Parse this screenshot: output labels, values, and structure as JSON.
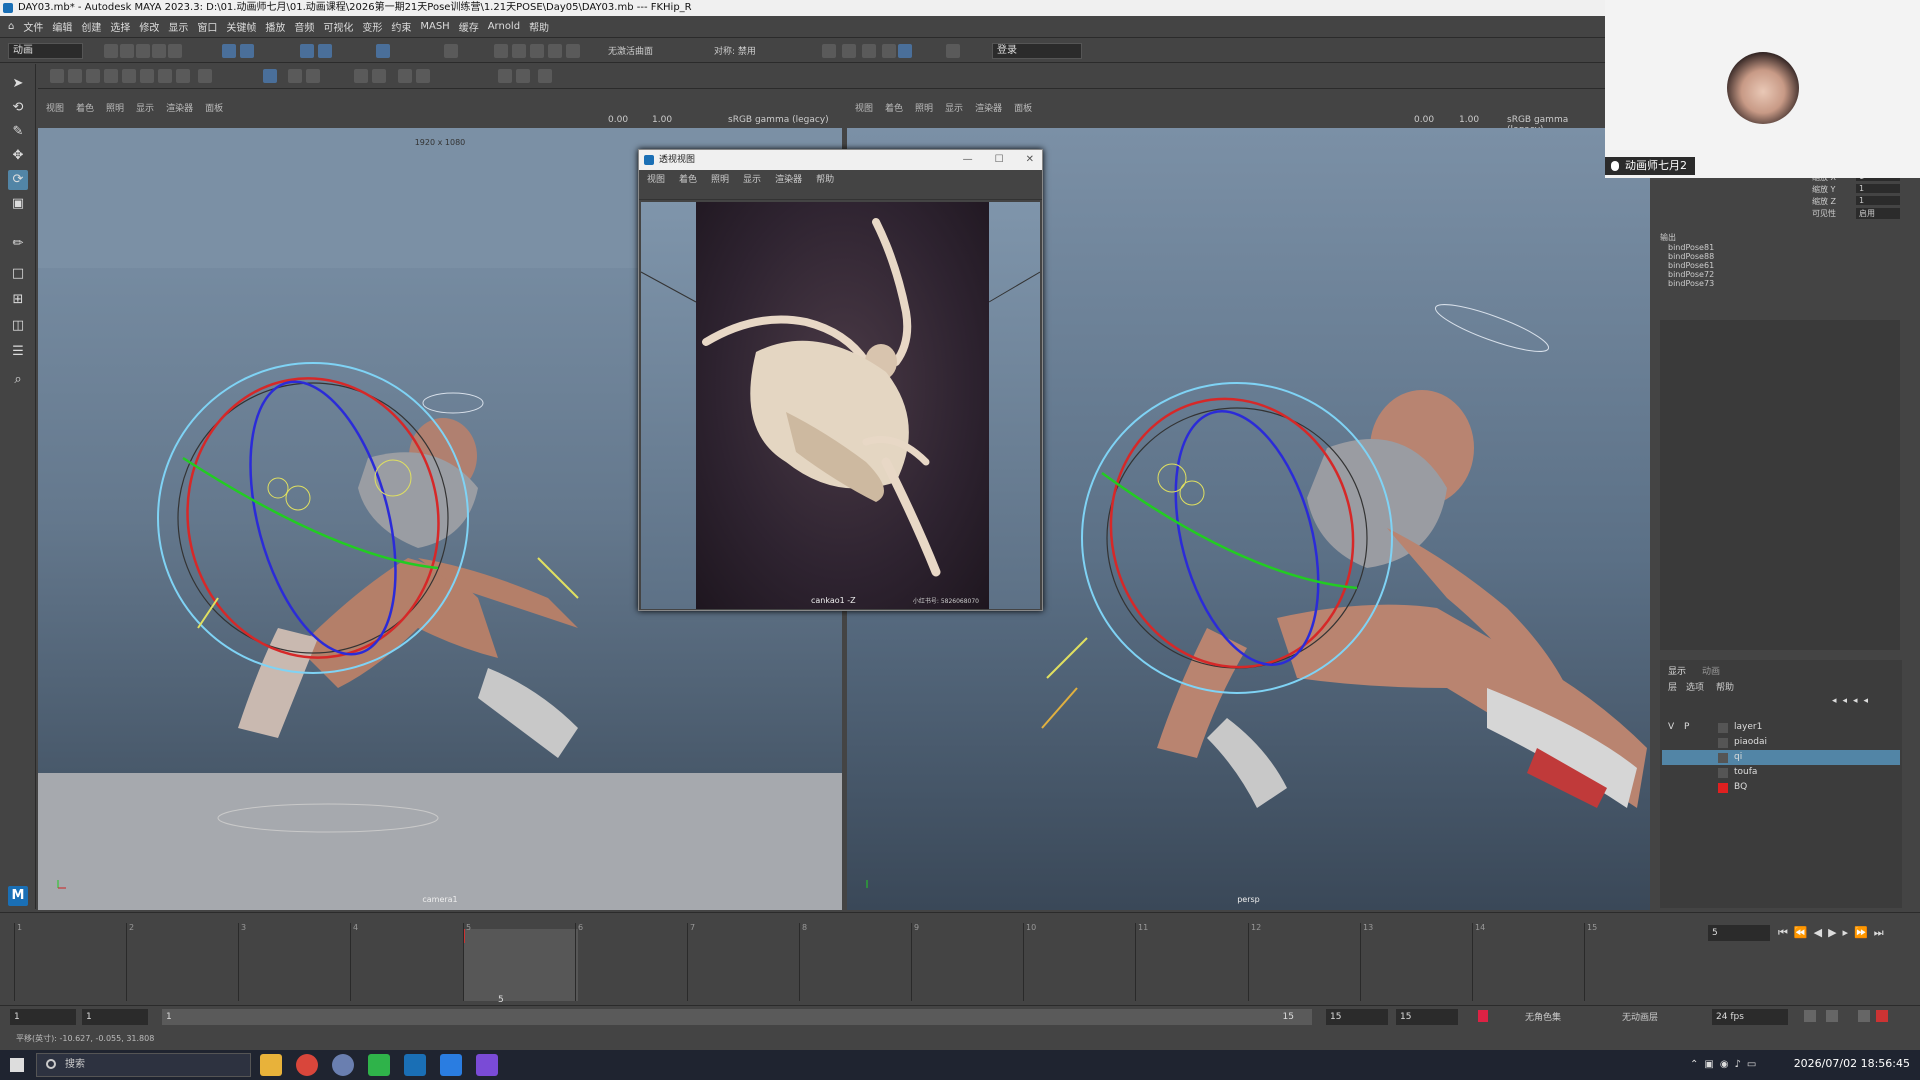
{
  "window": {
    "title": "DAY03.mb* - Autodesk MAYA 2023.3: D:\\01.动画师七月\\01.动画课程\\2026第一期21天Pose训练营\\1.21天POSE\\Day05\\DAY03.mb  ---  FKHip_R"
  },
  "menu": [
    "文件",
    "编辑",
    "创建",
    "选择",
    "修改",
    "显示",
    "窗口",
    "关键帧",
    "播放",
    "音频",
    "可视化",
    "变形",
    "约束",
    "MASH",
    "缓存",
    "Arnold",
    "帮助"
  ],
  "statusline": {
    "mode": "动画",
    "no_live": "无激活曲面",
    "symmetry": "对称: 禁用",
    "login": "登录"
  },
  "viewport_left": {
    "menu": [
      "视图",
      "着色",
      "照明",
      "显示",
      "渲染器",
      "面板"
    ],
    "exposure": "0.00",
    "gamma": "1.00",
    "colorspace": "sRGB gamma (legacy)",
    "resolution": "1920 x 1080",
    "camera": "camera1"
  },
  "viewport_right": {
    "menu": [
      "视图",
      "着色",
      "照明",
      "显示",
      "渲染器",
      "面板"
    ],
    "exposure": "0.00",
    "gamma": "1.00",
    "colorspace": "sRGB gamma (legacy)",
    "camera": "persp"
  },
  "float_window": {
    "title": "透视视图",
    "menu": [
      "视图",
      "着色",
      "照明",
      "显示",
      "渲染器",
      "帮助"
    ],
    "caption": "cankao1 -Z",
    "caption2": "小红书号: 5826068070"
  },
  "channel_box": {
    "rows": [
      {
        "label": "缩放 X",
        "value": "1"
      },
      {
        "label": "缩放 Y",
        "value": "1"
      },
      {
        "label": "缩放 Z",
        "value": "1"
      },
      {
        "label": "可见性",
        "value": "启用"
      }
    ],
    "outputs_label": "输出",
    "outputs": [
      "bindPose81",
      "bindPose88",
      "bindPose61",
      "bindPose72",
      "bindPose73"
    ]
  },
  "layer_panel": {
    "tabs": [
      "显示",
      "动画"
    ],
    "menu": [
      "层",
      "选项",
      "帮助"
    ],
    "layers": [
      {
        "v": "V",
        "p": "P",
        "name": "layer1",
        "selected": false,
        "color": "#555555"
      },
      {
        "v": "",
        "p": "",
        "name": "piaodai",
        "selected": false,
        "color": "#555555"
      },
      {
        "v": "",
        "p": "",
        "name": "qi",
        "selected": true,
        "color": "#555555"
      },
      {
        "v": "",
        "p": "",
        "name": "toufa",
        "selected": false,
        "color": "#555555"
      },
      {
        "v": "",
        "p": "",
        "name": "BQ",
        "selected": false,
        "color": "#e02020"
      }
    ]
  },
  "webcam": {
    "name": "动画师七月2"
  },
  "timeline": {
    "ticks": [
      "1",
      "2",
      "3",
      "4",
      "5",
      "6",
      "7",
      "8",
      "9",
      "10",
      "11",
      "12",
      "13",
      "14",
      "15"
    ],
    "current_frame": "5",
    "current_field": "5"
  },
  "range": {
    "start": "1",
    "start2": "1",
    "anim_start": "1",
    "end": "15",
    "end2": "15",
    "end3": "15",
    "char_set": "无角色集",
    "anim_layer": "无动画层",
    "fps": "24 fps"
  },
  "cmdline": {
    "text": "平移(英寸): -10.627, -0.055, 31.808"
  },
  "taskbar": {
    "search": "搜索",
    "datetime": "2026/07/02 18:56:45"
  }
}
